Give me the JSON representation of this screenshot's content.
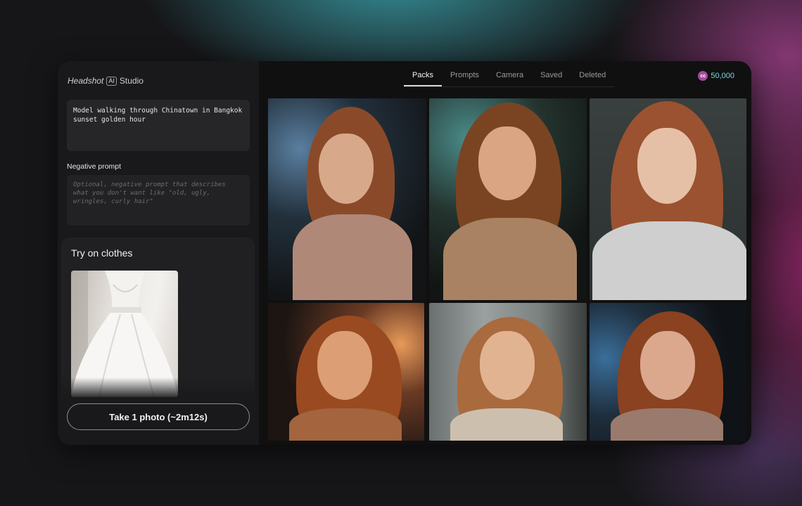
{
  "app": {
    "brand": {
      "part1": "Headshot",
      "badge": "AI",
      "part2": "Studio"
    },
    "credits": {
      "icon": "cc",
      "value": "50,000"
    }
  },
  "prompt": {
    "value": "Model walking through Chinatown in Bangkok\nsunset golden hour"
  },
  "negative_prompt": {
    "label": "Negative prompt",
    "placeholder": "Optional, negative prompt that describes what you don't want like \"old, ugly, wringles, curly hair\""
  },
  "clothes": {
    "title": "Try on clothes"
  },
  "action": {
    "label": "Take 1 photo (~2m12s)"
  },
  "tabs": [
    {
      "label": "Packs",
      "active": true
    },
    {
      "label": "Prompts",
      "active": false
    },
    {
      "label": "Camera",
      "active": false
    },
    {
      "label": "Saved",
      "active": false
    },
    {
      "label": "Deleted",
      "active": false
    }
  ],
  "colors": {
    "accent_credits": "#7fd6e0",
    "credits_icon": "#a44aa0"
  }
}
